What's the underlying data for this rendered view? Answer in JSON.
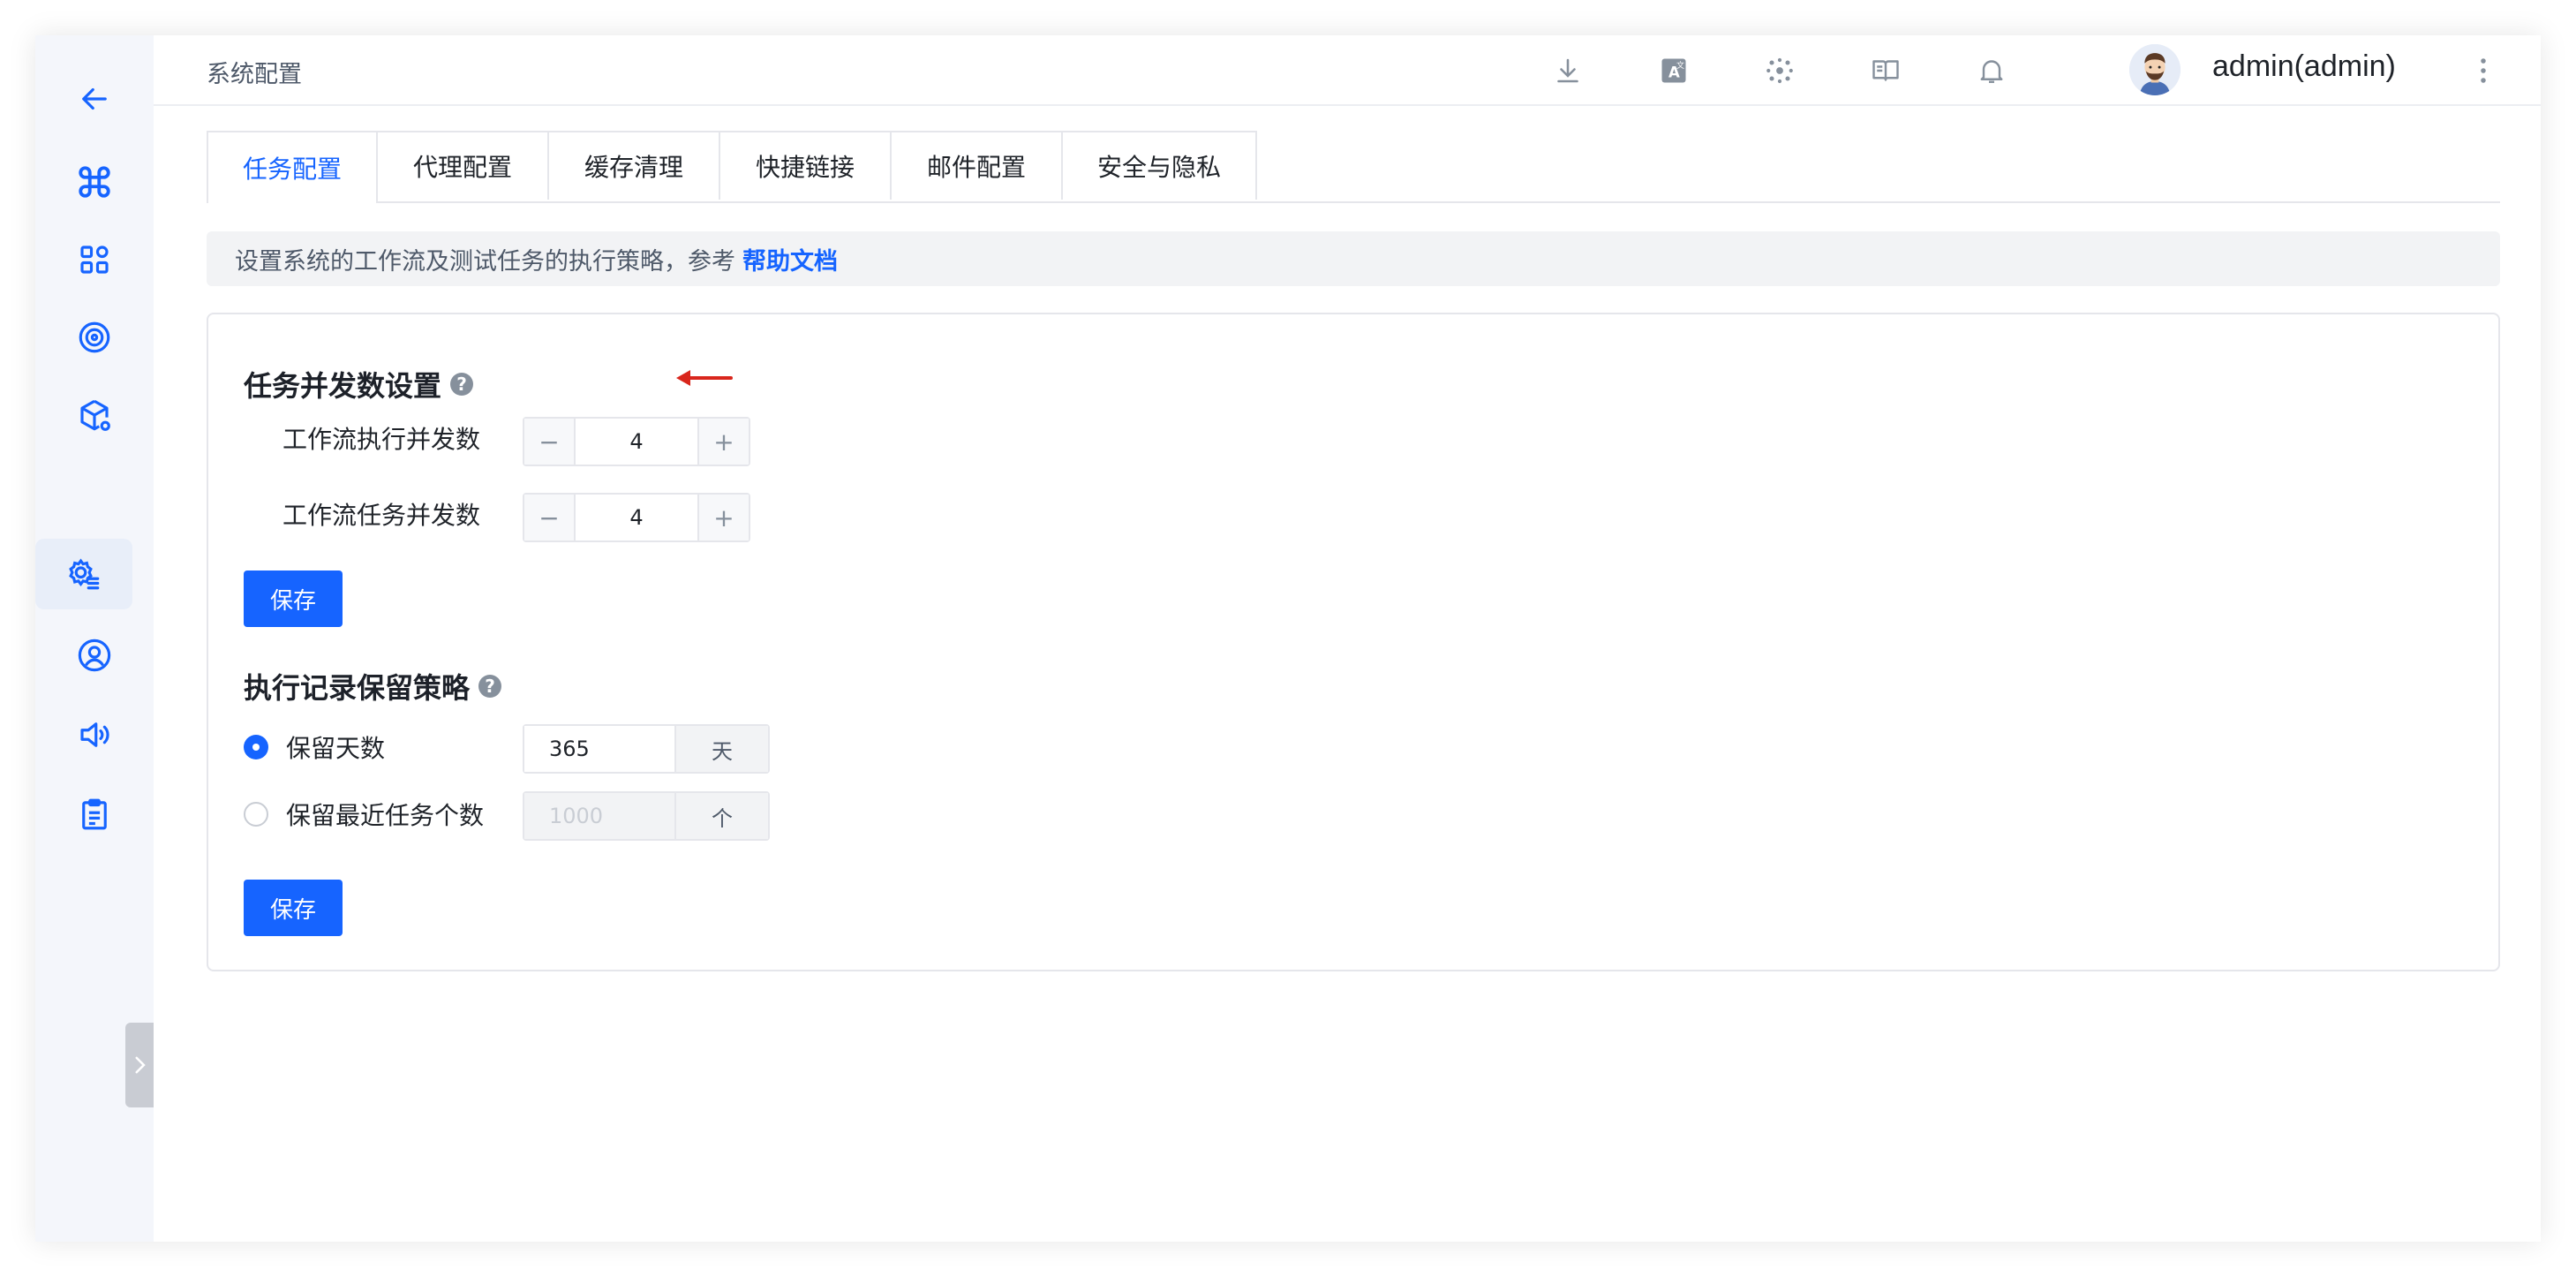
{
  "header": {
    "title": "系统配置",
    "user": "admin(admin)"
  },
  "tabs": [
    {
      "label": "任务配置"
    },
    {
      "label": "代理配置"
    },
    {
      "label": "缓存清理"
    },
    {
      "label": "快捷链接"
    },
    {
      "label": "邮件配置"
    },
    {
      "label": "安全与隐私"
    }
  ],
  "info": {
    "text": "设置系统的工作流及测试任务的执行策略，参考",
    "link": "帮助文档"
  },
  "concurrency": {
    "title": "任务并发数设置",
    "help": "?",
    "rows": [
      {
        "label": "工作流执行并发数",
        "value": "4"
      },
      {
        "label": "工作流任务并发数",
        "value": "4"
      }
    ],
    "minus": "−",
    "plus": "+",
    "save": "保存"
  },
  "retention": {
    "title": "执行记录保留策略",
    "help": "?",
    "options": [
      {
        "label": "保留天数",
        "value": "365",
        "unit": "天",
        "selected": true
      },
      {
        "label": "保留最近任务个数",
        "value": "1000",
        "unit": "个",
        "selected": false
      }
    ],
    "save": "保存"
  },
  "colors": {
    "accent": "#1664ff",
    "annotation_arrow": "#d9261c"
  },
  "icons": {
    "sidebar": [
      "back-arrow-icon",
      "command-icon",
      "apps-grid-icon",
      "target-icon",
      "package-settings-icon",
      "settings-list-icon",
      "user-circle-icon",
      "speaker-icon",
      "clipboard-icon"
    ],
    "header": [
      "download-icon",
      "translate-icon",
      "network-icon",
      "book-icon",
      "bell-icon",
      "more-vertical-icon"
    ]
  }
}
